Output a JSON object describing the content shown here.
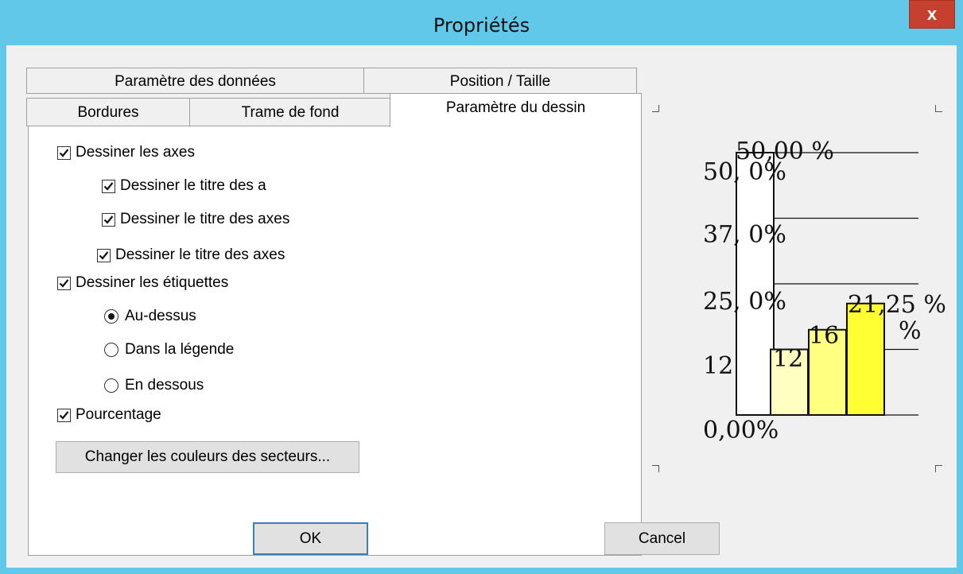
{
  "window": {
    "title": "Propriétés",
    "close_label": "x"
  },
  "tabs": {
    "row1": [
      "Paramètre des données",
      "Position / Taille"
    ],
    "row2": [
      "Bordures",
      "Trame de fond",
      "Paramètre du dessin"
    ]
  },
  "options": {
    "draw_axes": {
      "label": "Dessiner les axes",
      "checked": true
    },
    "axis_title_1": {
      "label": "Dessiner le titre des a",
      "checked": true
    },
    "axis_title_2": {
      "label": "Dessiner le titre des axes",
      "checked": true
    },
    "axis_title_3": {
      "label": "Dessiner le titre des axes",
      "checked": true
    },
    "draw_labels": {
      "label": "Dessiner les étiquettes",
      "checked": true
    },
    "label_above": {
      "label": "Au-dessus",
      "selected": true
    },
    "label_legend": {
      "label": "Dans la légende",
      "selected": false
    },
    "label_below": {
      "label": "En dessous",
      "selected": false
    },
    "percentage": {
      "label": "Pourcentage",
      "checked": true
    }
  },
  "buttons": {
    "change_colors": "Changer les couleurs des secteurs...",
    "ok": "OK",
    "cancel": "Cancel"
  },
  "chart_data": {
    "type": "bar",
    "ylim": [
      0,
      50
    ],
    "y_ticks": [
      0,
      12.5,
      25,
      37.5,
      50
    ],
    "y_tick_labels": [
      "0,00%",
      "12",
      "25,  0%",
      "37,  0%",
      "50,  0%"
    ],
    "values": [
      50.0,
      12.5,
      16.25,
      21.25
    ],
    "data_labels": [
      "50,00 %",
      "12",
      "16",
      "21,25 %"
    ],
    "extra_label": "%",
    "colors": [
      "#ffffff",
      "#ffffc0",
      "#ffff80",
      "#ffff33"
    ],
    "grid": true
  }
}
